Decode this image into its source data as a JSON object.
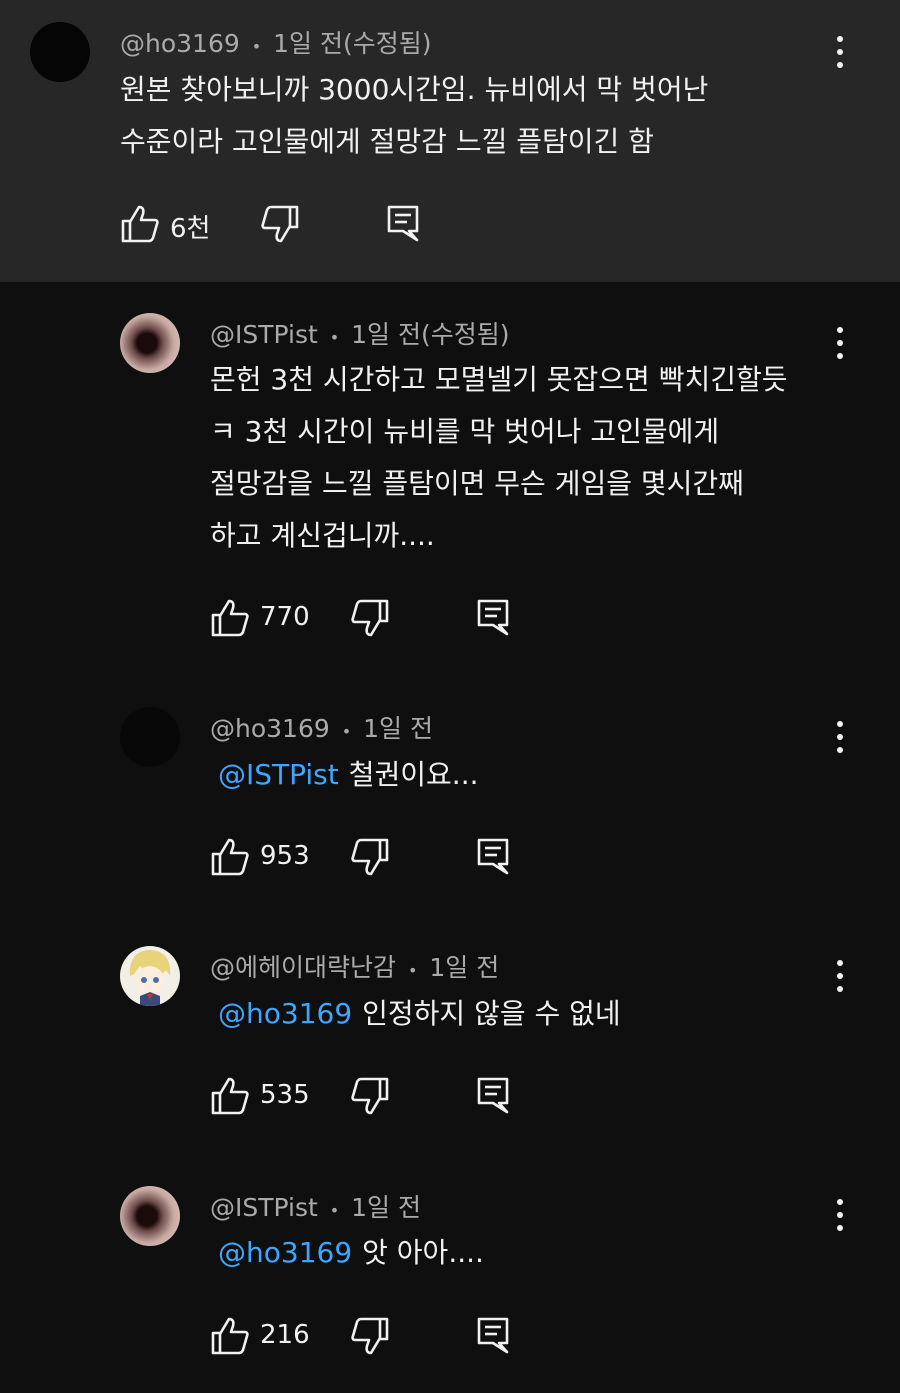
{
  "colors": {
    "background": "#0f0f0f",
    "highlight_background": "#272727",
    "text": "#f1f1f1",
    "meta": "#aaaaaa",
    "mention": "#3ea6ff"
  },
  "comments": [
    {
      "author": "@ho3169",
      "sep": "•",
      "time": "1일 전(수정됨)",
      "lines": [
        "원본 찾아보니까 3000시간임. 뉴비에서 막 벗어난",
        "수준이라 고인물에게 절망감 느낄 플탐이긴 함"
      ],
      "likes": "6천"
    },
    {
      "author": "@ISTPist",
      "sep": "•",
      "time": "1일 전(수정됨)",
      "lines": [
        "몬헌 3천 시간하고 모멸넬기 못잡으면 빡치긴할듯",
        "ㅋ 3천 시간이 뉴비를 막 벗어나 고인물에게",
        "절망감을 느낄 플탐이면 무슨 게임을 몇시간째",
        "하고 계신겁니까...."
      ],
      "likes": "770"
    },
    {
      "author": "@ho3169",
      "sep": "•",
      "time": "1일 전",
      "mention": "@ISTPist",
      "text": "철권이요...",
      "likes": "953"
    },
    {
      "author": "@에헤이대략난감",
      "sep": "•",
      "time": "1일 전",
      "mention": "@ho3169",
      "text": "인정하지 않을 수 없네",
      "likes": "535"
    },
    {
      "author": "@ISTPist",
      "sep": "•",
      "time": "1일 전",
      "mention": "@ho3169",
      "text": "앗 아아....",
      "likes": "216"
    }
  ],
  "icons": [
    "more-vert-icon",
    "like-icon",
    "dislike-icon",
    "reply-icon"
  ]
}
